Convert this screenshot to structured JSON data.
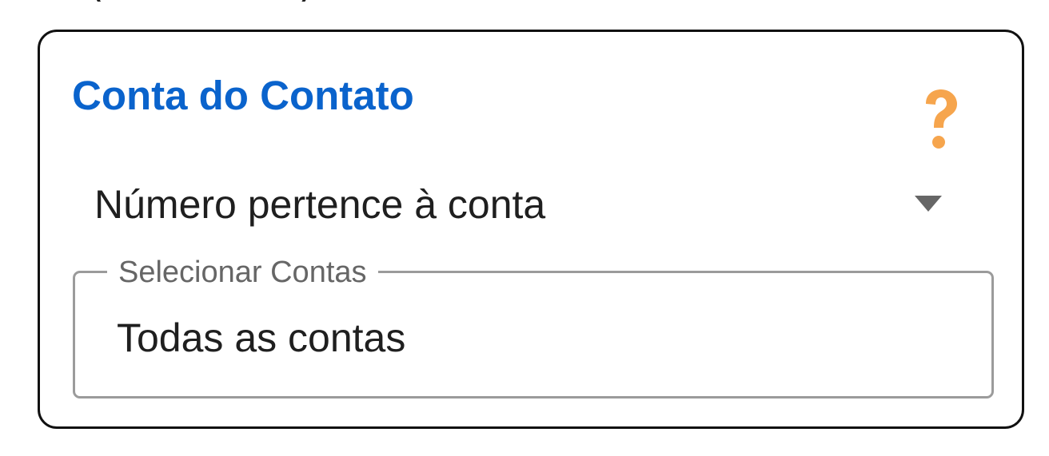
{
  "colors": {
    "title": "#0a63cc",
    "help_icon": "#f6a54d",
    "text": "#1f1f1f",
    "label": "#666666",
    "field_border": "#9b9b9b",
    "card_border": "#111111",
    "caret": "#666666"
  },
  "card": {
    "title": "Conta do Contato",
    "help_icon": "question-mark-icon",
    "condition": {
      "selected": "Número pertence à conta",
      "caret_icon": "chevron-down-icon"
    },
    "accounts_field": {
      "label": "Selecionar Contas",
      "value": "Todas as contas"
    }
  }
}
